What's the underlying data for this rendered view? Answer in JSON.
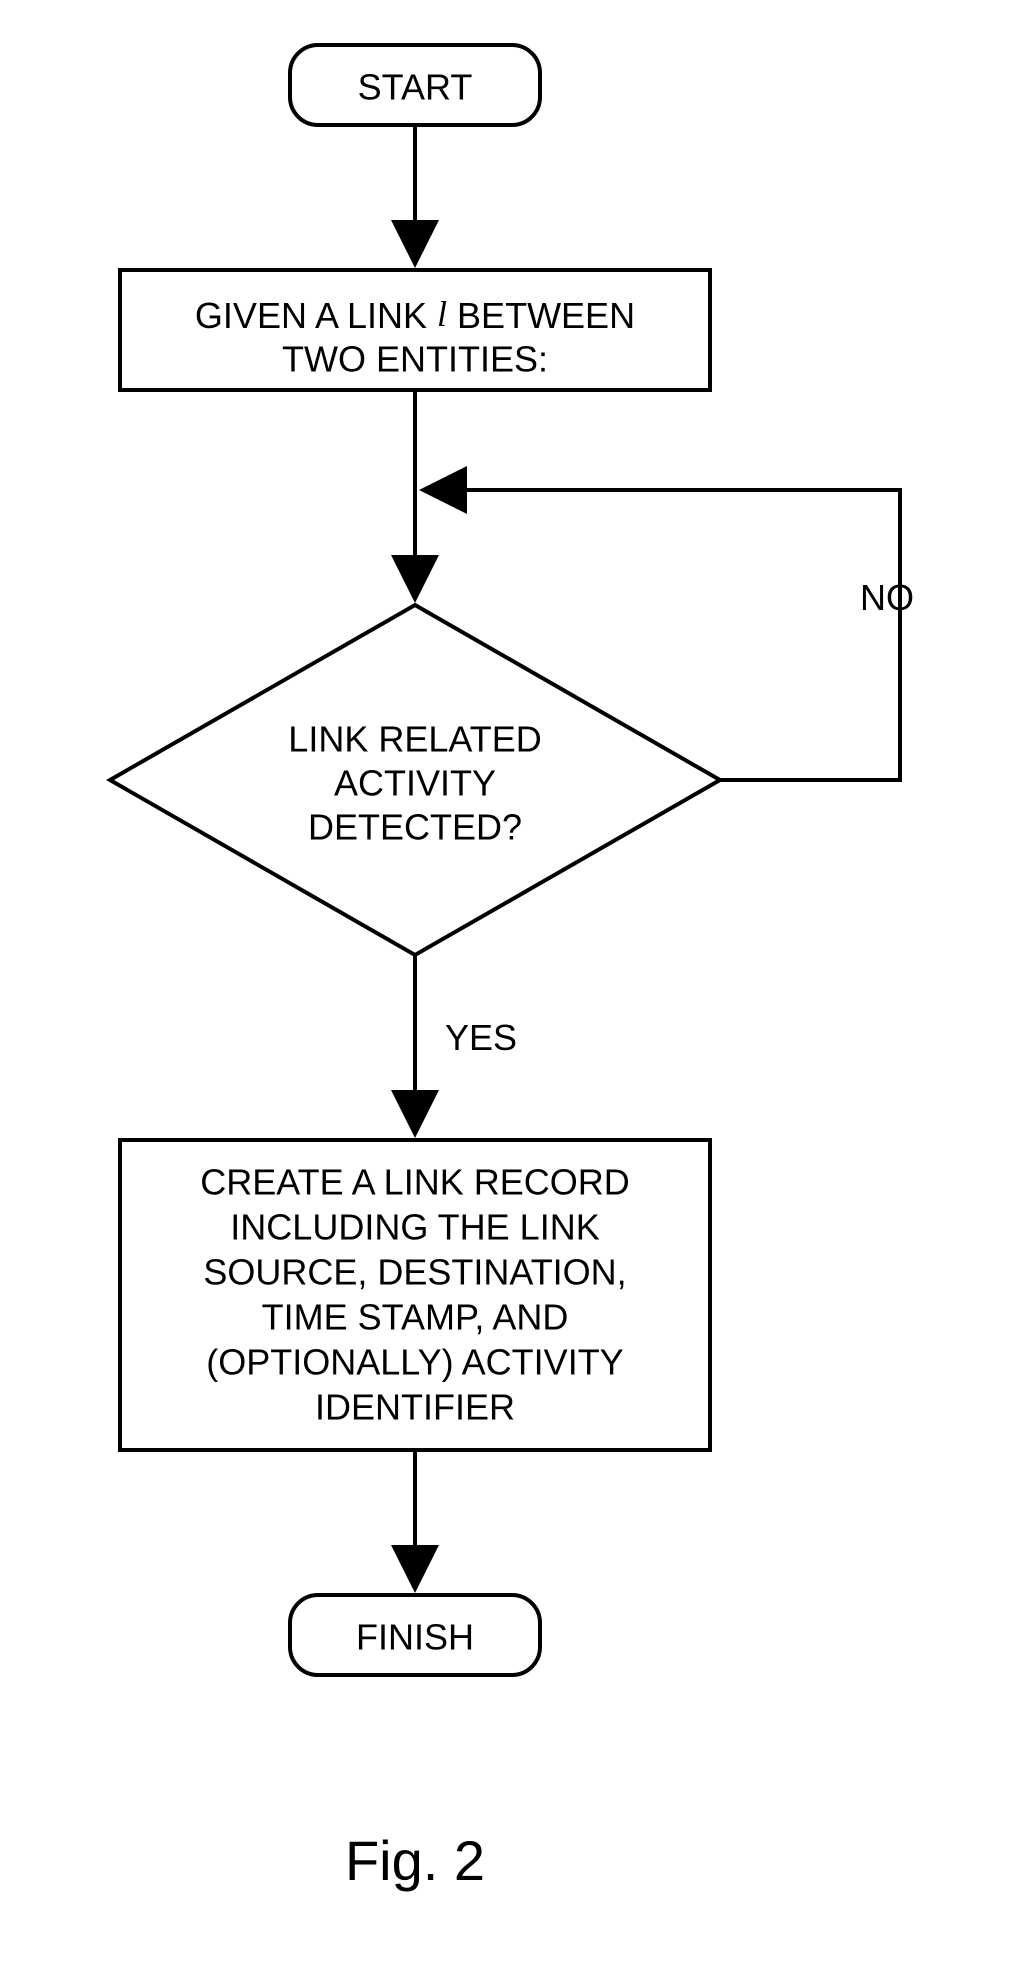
{
  "flowchart": {
    "start": "START",
    "given_line1": "GIVEN A LINK ",
    "given_italic": "l",
    "given_line1_after": " BETWEEN",
    "given_line2": "TWO ENTITIES:",
    "decision_line1": "LINK RELATED",
    "decision_line2": "ACTIVITY",
    "decision_line3": "DETECTED?",
    "process_line1": "CREATE A LINK RECORD",
    "process_line2": "INCLUDING THE LINK",
    "process_line3": "SOURCE, DESTINATION,",
    "process_line4": "TIME STAMP, AND",
    "process_line5": "(OPTIONALLY) ACTIVITY",
    "process_line6": "IDENTIFIER",
    "finish": "FINISH",
    "no_label": "NO",
    "yes_label": "YES"
  },
  "caption": "Fig. 2"
}
